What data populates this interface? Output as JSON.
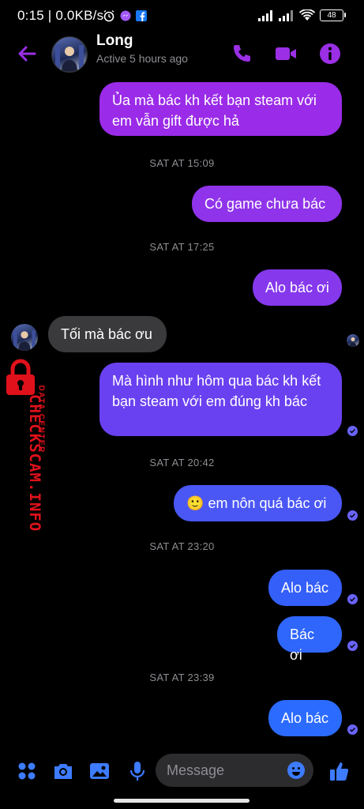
{
  "status_bar": {
    "time": "0:15 | 0.0KB/s",
    "battery": "48"
  },
  "header": {
    "name": "Long",
    "status": "Active 5 hours ago"
  },
  "messages": [
    {
      "type": "sent",
      "text": "Ủa mà bác kh kết bạn steam với em vẫn gift được hả"
    },
    {
      "type": "timestamp",
      "text": "SAT AT 15:09"
    },
    {
      "type": "sent",
      "text": "Có game chưa bác"
    },
    {
      "type": "timestamp",
      "text": "SAT AT 17:25"
    },
    {
      "type": "sent",
      "text": "Alo bác ơi"
    },
    {
      "type": "received",
      "text": "Tối mà bác ơu"
    },
    {
      "type": "sent",
      "text": "Mà hình như hôm qua bác kh kết bạn steam với em đúng kh bác"
    },
    {
      "type": "timestamp",
      "text": "SAT AT 20:42"
    },
    {
      "type": "sent",
      "text": "em nôn quá bác ơi",
      "emoji": "🙂"
    },
    {
      "type": "timestamp",
      "text": "SAT AT 23:20"
    },
    {
      "type": "sent",
      "text": "Alo bác"
    },
    {
      "type": "sent",
      "text": "Bác ơi"
    },
    {
      "type": "timestamp",
      "text": "SAT AT 23:39"
    },
    {
      "type": "sent",
      "text": "Alo bác"
    }
  ],
  "watermark": {
    "main": "CHECKSCAM.INFO",
    "sub": "DATA CENTER"
  },
  "composer": {
    "placeholder": "Message"
  },
  "icons": {
    "back": "arrow-left-icon",
    "call": "phone-icon",
    "video": "video-camera-icon",
    "info": "info-icon",
    "apps": "four-dots-icon",
    "camera": "camera-icon",
    "gallery": "image-icon",
    "mic": "microphone-icon",
    "emoji": "smiley-icon",
    "like": "thumbs-up-icon"
  },
  "colors": {
    "accent_purple": "#9b2fe6",
    "bubble_top": "#9a2be8",
    "bubble_mid": "#6b3ff0",
    "bubble_bottom": "#2b6bff",
    "received_bubble": "#3a3a3c",
    "icon_blue": "#3d7bff"
  }
}
